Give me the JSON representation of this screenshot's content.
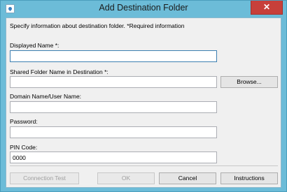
{
  "window": {
    "title": "Add Destination Folder",
    "close_glyph": "✕"
  },
  "instruction": "Specify information about destination folder. *Required information",
  "fields": {
    "displayed_name": {
      "label": "Displayed Name *:",
      "value": ""
    },
    "shared_folder": {
      "label": "Shared Folder Name in Destination *:",
      "value": ""
    },
    "domain_user": {
      "label": "Domain Name/User Name:",
      "value": ""
    },
    "password": {
      "label": "Password:",
      "value": ""
    },
    "pin_code": {
      "label": "PIN Code:",
      "value": "0000"
    }
  },
  "buttons": {
    "browse": "Browse...",
    "connection_test": "Connection Test",
    "ok": "OK",
    "cancel": "Cancel",
    "instructions": "Instructions"
  },
  "colors": {
    "title_bar": "#6cbcd8",
    "close_button": "#c7403a",
    "focus_border": "#3c7fb1"
  }
}
